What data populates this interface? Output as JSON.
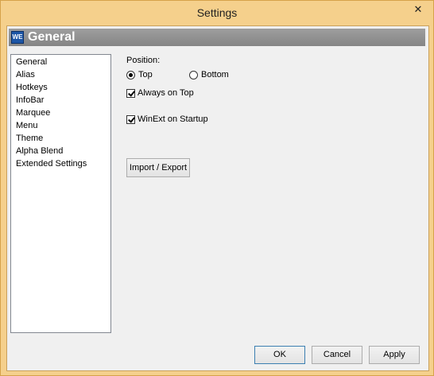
{
  "window": {
    "title": "Settings",
    "close_glyph": "✕"
  },
  "app_icon": {
    "text": "WE"
  },
  "section": {
    "title": "General"
  },
  "nav": {
    "items": [
      {
        "label": "General"
      },
      {
        "label": "Alias"
      },
      {
        "label": "Hotkeys"
      },
      {
        "label": "InfoBar"
      },
      {
        "label": "Marquee"
      },
      {
        "label": "Menu"
      },
      {
        "label": "Theme"
      },
      {
        "label": "Alpha Blend"
      },
      {
        "label": "Extended Settings"
      }
    ]
  },
  "general": {
    "position_label": "Position:",
    "options": [
      {
        "label": "Top",
        "selected": true
      },
      {
        "label": "Bottom",
        "selected": false
      }
    ],
    "always_on_top": {
      "label": "Always on Top",
      "checked": true
    },
    "startup": {
      "label": "WinExt on Startup",
      "checked": true
    },
    "import_export_label": "Import / Export"
  },
  "buttons": {
    "ok": "OK",
    "cancel": "Cancel",
    "apply": "Apply"
  },
  "colors": {
    "frame": "#f5d08c",
    "header": "#8c8c8c",
    "client": "#f0f0f0"
  }
}
